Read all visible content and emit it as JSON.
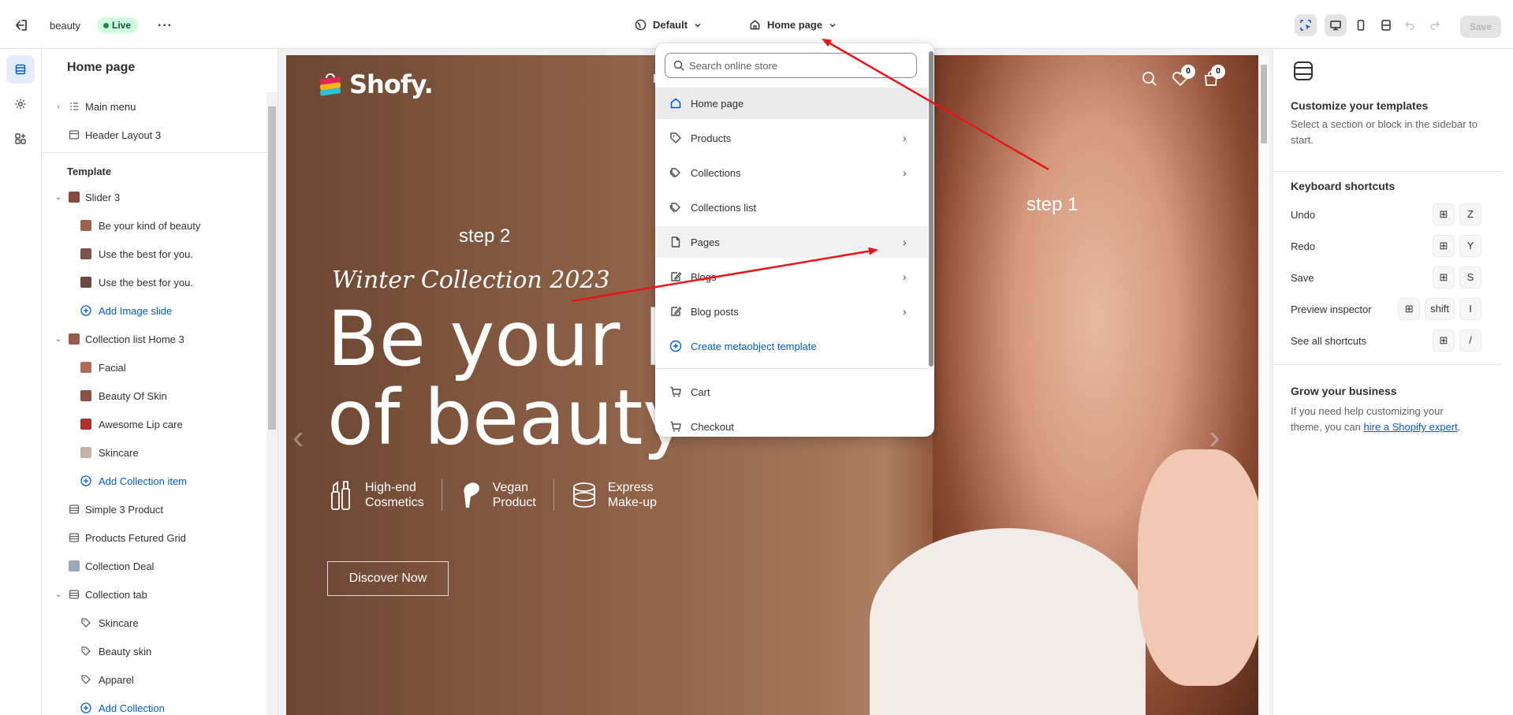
{
  "topbar": {
    "store_name": "beauty",
    "status_badge": "Live",
    "theme_selector": "Default",
    "page_selector": "Home page",
    "save_label": "Save"
  },
  "sidebar": {
    "title": "Home page",
    "items": [
      {
        "label": "Main menu"
      },
      {
        "label": "Header Layout 3"
      },
      {
        "label": "Template"
      },
      {
        "label": "Slider 3"
      },
      {
        "label": "Be your kind of beauty"
      },
      {
        "label": "Use the best for you."
      },
      {
        "label": "Use the best for you."
      },
      {
        "label": "Add Image slide"
      },
      {
        "label": "Collection list Home 3"
      },
      {
        "label": "Facial"
      },
      {
        "label": "Beauty Of Skin"
      },
      {
        "label": "Awesome Lip care"
      },
      {
        "label": "Skincare"
      },
      {
        "label": "Add Collection item"
      },
      {
        "label": "Simple 3 Product"
      },
      {
        "label": "Products Fetured Grid"
      },
      {
        "label": "Collection Deal"
      },
      {
        "label": "Collection tab"
      },
      {
        "label": "Skincare"
      },
      {
        "label": "Beauty skin"
      },
      {
        "label": "Apparel"
      },
      {
        "label": "Add Collection"
      }
    ]
  },
  "preview": {
    "logo_text": "Shofy.",
    "nav_letter": "H",
    "wishlist_count": "0",
    "cart_count": "0",
    "subtitle": "Winter Collection 2023",
    "headline": "Be your ki\nof beauty",
    "features": [
      {
        "line1": "High-end",
        "line2": "Cosmetics"
      },
      {
        "line1": "Vegan",
        "line2": "Product"
      },
      {
        "line1": "Express",
        "line2": "Make-up"
      }
    ],
    "cta": "Discover Now"
  },
  "dropdown": {
    "search_placeholder": "Search online store",
    "items": [
      {
        "label": "Home page"
      },
      {
        "label": "Products"
      },
      {
        "label": "Collections"
      },
      {
        "label": "Collections list"
      },
      {
        "label": "Pages"
      },
      {
        "label": "Blogs"
      },
      {
        "label": "Blog posts"
      },
      {
        "label": "Create metaobject template"
      },
      {
        "label": "Cart"
      },
      {
        "label": "Checkout"
      }
    ]
  },
  "right_panel": {
    "title": "Customize your templates",
    "desc": "Select a section or block in the sidebar to start.",
    "shortcuts_title": "Keyboard shortcuts",
    "shortcuts": [
      {
        "label": "Undo",
        "key": "Z"
      },
      {
        "label": "Redo",
        "key": "Y"
      },
      {
        "label": "Save",
        "key": "S"
      },
      {
        "label": "Preview inspector",
        "key": "I",
        "mod2": "shift"
      },
      {
        "label": "See all shortcuts",
        "key": "/"
      }
    ],
    "grow_title": "Grow your business",
    "grow_text": "If you need help customizing your theme, you can ",
    "grow_link": "hire a Shopify expert",
    "grow_end": "."
  },
  "annotations": {
    "step1": "step 1",
    "step2": "step 2",
    "color": "#e8141a"
  }
}
